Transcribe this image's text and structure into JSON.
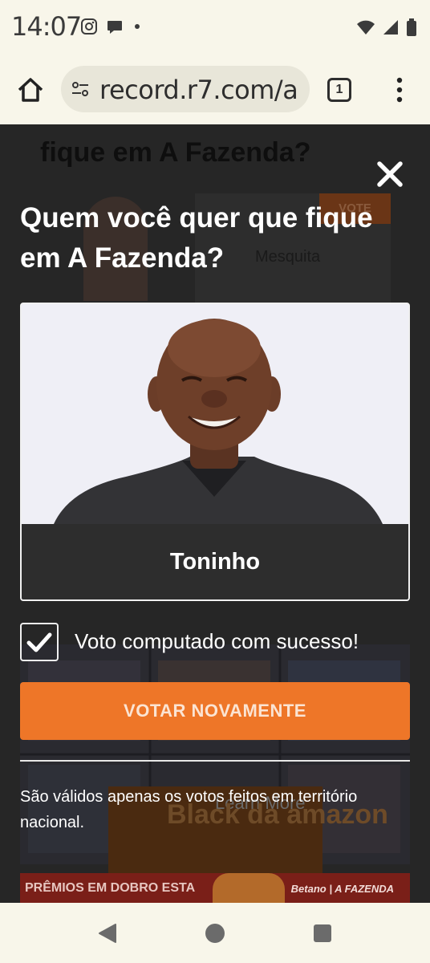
{
  "status_bar": {
    "time": "14:07",
    "icons_left": [
      "instagram-icon",
      "chat-bubble-icon",
      "dot-icon"
    ],
    "icons_right": [
      "wifi-icon",
      "signal-icon",
      "battery-icon"
    ]
  },
  "browser": {
    "url": "record.r7.com/a",
    "tab_count": "1"
  },
  "background_page": {
    "title": "fique em A Fazenda?",
    "vote_label": "VOTE",
    "card_name": "Mesquita",
    "ad_learn_more": "Learn More",
    "ad_brand": "Black da amazon",
    "banner_left": "PRÊMIOS EM DOBRO ESTA",
    "banner_right": "Betano | A FAZENDA"
  },
  "dialog": {
    "title": "Quem você quer que fique em A Fazenda?",
    "candidate_name": "Toninho",
    "success_message": "Voto computado com sucesso!",
    "vote_again_label": "VOTAR NOVAMENTE",
    "disclaimer": "São válidos apenas os votos feitos em território nacional."
  },
  "colors": {
    "accent": "#ee7628",
    "overlay": "#262626",
    "chrome": "#f8f6ea"
  }
}
